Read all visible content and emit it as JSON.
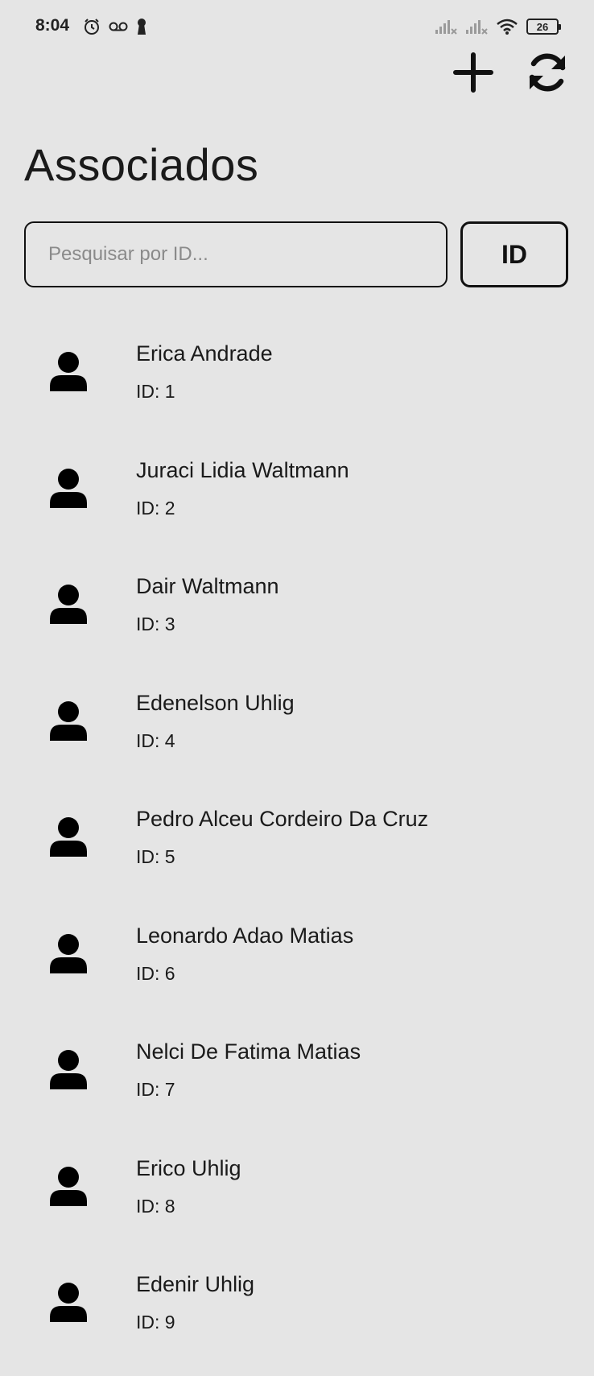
{
  "status_bar": {
    "time": "8:04",
    "battery": "26",
    "icons_left": [
      "alarm-icon",
      "voicemail-icon",
      "keyhole-icon"
    ],
    "icons_right": [
      "signal-icon",
      "signal-icon",
      "wifi-icon",
      "battery-icon"
    ]
  },
  "header": {
    "title": "Associados",
    "actions": [
      "add-icon",
      "refresh-icon"
    ]
  },
  "search": {
    "placeholder": "Pesquisar por ID...",
    "value": "",
    "button_label": "ID"
  },
  "list": {
    "id_prefix": "ID:",
    "items": [
      {
        "name": "Erica Andrade",
        "id": "1"
      },
      {
        "name": "Juraci Lidia Waltmann",
        "id": "2"
      },
      {
        "name": "Dair Waltmann",
        "id": "3"
      },
      {
        "name": "Edenelson Uhlig",
        "id": "4"
      },
      {
        "name": "Pedro Alceu Cordeiro Da Cruz",
        "id": "5"
      },
      {
        "name": "Leonardo Adao Matias",
        "id": "6"
      },
      {
        "name": "Nelci De Fatima Matias",
        "id": "7"
      },
      {
        "name": "Erico Uhlig",
        "id": "8"
      },
      {
        "name": "Edenir Uhlig",
        "id": "9"
      }
    ]
  }
}
